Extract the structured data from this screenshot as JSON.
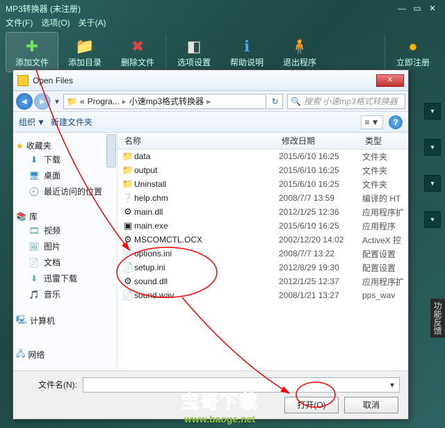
{
  "app": {
    "title": "MP3转换器 (未注册)",
    "menu": {
      "file": "文件(F)",
      "options": "选项(O)",
      "about": "关于(A)"
    }
  },
  "toolbar": {
    "add_file": "添加文件",
    "add_dir": "添加目录",
    "del_file": "删除文件",
    "opts": "选项设置",
    "help": "帮助说明",
    "exit": "退出程序",
    "reg": "立即注册"
  },
  "feedback": "功能反馈",
  "dialog": {
    "title": "Open Files",
    "breadcrumb": {
      "b1": "«",
      "b2": "Progra...",
      "b3": "小速mp3格式转换器"
    },
    "search_placeholder": "搜索 小速mp3格式转换器",
    "cmd": {
      "organize": "组织",
      "new_folder": "新建文件夹"
    },
    "nav": {
      "favorites": "收藏夹",
      "downloads": "下载",
      "desktop": "桌面",
      "recent": "最近访问的位置",
      "libraries": "库",
      "videos": "视频",
      "pictures": "图片",
      "documents": "文档",
      "xunlei": "迅雷下载",
      "music": "音乐",
      "computer": "计算机",
      "network": "网络"
    },
    "cols": {
      "name": "名称",
      "date": "修改日期",
      "type": "类型"
    },
    "rows": [
      {
        "name": "data",
        "date": "2015/6/10 16:25",
        "type": "文件夹",
        "icon": "📁"
      },
      {
        "name": "output",
        "date": "2015/6/10 16:25",
        "type": "文件夹",
        "icon": "📁"
      },
      {
        "name": "Uninstall",
        "date": "2015/6/10 16:25",
        "type": "文件夹",
        "icon": "📁"
      },
      {
        "name": "help.chm",
        "date": "2008/7/7 13:59",
        "type": "编译的 HT",
        "icon": "❔"
      },
      {
        "name": "main.dll",
        "date": "2012/1/25 12:36",
        "type": "应用程序扩",
        "icon": "⚙"
      },
      {
        "name": "main.exe",
        "date": "2015/6/10 16:25",
        "type": "应用程序",
        "icon": "▣"
      },
      {
        "name": "MSCOMCTL.OCX",
        "date": "2002/12/20 14:02",
        "type": "ActiveX 控",
        "icon": "⚙"
      },
      {
        "name": "options.ini",
        "date": "2008/7/7 13:22",
        "type": "配置设置",
        "icon": "📄"
      },
      {
        "name": "setup.ini",
        "date": "2012/8/29 19:30",
        "type": "配置设置",
        "icon": "📄"
      },
      {
        "name": "sound.dll",
        "date": "2012/1/25 12:37",
        "type": "应用程序扩",
        "icon": "⚙"
      },
      {
        "name": "sound.wav",
        "date": "2008/1/21 13:27",
        "type": "pps_wav",
        "icon": "📄"
      }
    ],
    "fn_label": "文件名(N):",
    "open": "打开(O)",
    "cancel": "取消"
  },
  "watermark": {
    "line1": "宝哥下载",
    "line2": "www.baoge.net"
  }
}
